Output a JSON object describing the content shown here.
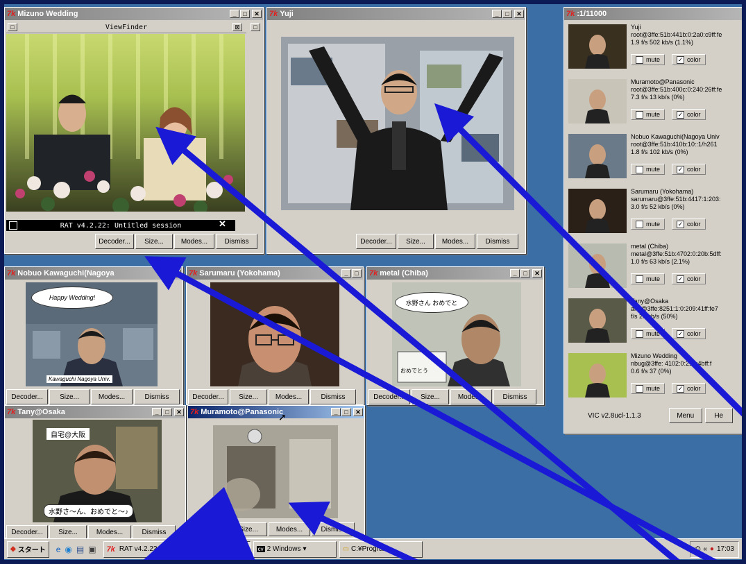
{
  "windows": {
    "mizuno": {
      "title": "Mizuno Wedding",
      "viewfinder": "ViewFinder",
      "rat_session": "RAT v4.2.22: Untitled session",
      "buttons": [
        "Decoder...",
        "Size...",
        "Modes...",
        "Dismiss"
      ]
    },
    "yuji": {
      "title": "Yuji",
      "buttons": [
        "Decoder...",
        "Size...",
        "Modes...",
        "Dismiss"
      ]
    },
    "nobuo": {
      "title": "Nobuo Kawaguchi(Nagoya",
      "speech_top": "Happy Wedding!",
      "speech_bottom": "Kawaguchi Nagoya Univ.",
      "buttons": [
        "Decoder...",
        "Size...",
        "Modes...",
        "Dismiss"
      ]
    },
    "sarumaru": {
      "title": "Sarumaru (Yokohama)",
      "buttons": [
        "Decoder...",
        "Size...",
        "Modes...",
        "Dismiss"
      ]
    },
    "metal": {
      "title": "metal (Chiba)",
      "speech": "水野さん おめでと",
      "sign": "おめでとう",
      "buttons": [
        "Decoder...",
        "Size...",
        "Modes...",
        "Dismiss"
      ]
    },
    "tany": {
      "title": "Tany@Osaka",
      "caption_top": "自宅@大阪",
      "caption_bottom": "水野さ〜ん、おめでと〜♪",
      "buttons": [
        "Decoder...",
        "Size...",
        "Modes...",
        "Dismiss"
      ]
    },
    "muramoto": {
      "title": "Muramoto@Panasonic",
      "buttons": [
        "Size...",
        "Modes...",
        "Dismiss"
      ]
    }
  },
  "vic": {
    "title": ":1/11000",
    "mute_label": "mute",
    "color_label": "color",
    "entries": [
      {
        "name": "Yuji",
        "addr": "root@3ffe:51b:441b:0:2a0:c9ff:fe",
        "stats": "1.9 f/s   502 kb/s  (1.1%)"
      },
      {
        "name": "Muramoto@Panasonic",
        "addr": "root@3ffe:51b:400c:0:240:26ff:fe",
        "stats": "7.3 f/s    13 kb/s    (0%)"
      },
      {
        "name": "Nobuo Kawaguchi(Nagoya Univ",
        "addr": "root@3ffe:51b:410b:10::1/h261",
        "stats": "1.8 f/s   102 kb/s    (0%)"
      },
      {
        "name": "Sarumaru (Yokohama)",
        "addr": "sarumaru@3ffe:51b:4417:1:203:",
        "stats": "3.0 f/s    52 kb/s    (0%)"
      },
      {
        "name": "metal (Chiba)",
        "addr": "metal@3ffe:51b:4702:0:20b:5dff:",
        "stats": "1.0 f/s    63 kb/s  (2.1%)"
      },
      {
        "name": "Tany@Osaka",
        "addr": "any@3ffe:8251:1:0:209:41ff:fe7",
        "stats": "f/s    26 kb/s   (50%)"
      },
      {
        "name": "Mizuno Wedding",
        "addr": "nbug@3ffe:  4102:0:210:4bff:f",
        "stats": "0.6 f/s    37        (0%)"
      }
    ],
    "footer_version": "VIC v2.8ucl-1.1.3",
    "menu_label": "Menu",
    "help_label": "He"
  },
  "taskbar": {
    "start_label": "スタート",
    "items": [
      "RAT v4.2.22:",
      "Camtasia",
      "2 Windows",
      "C:¥Program ..."
    ],
    "clock": "17:03"
  },
  "colors": {
    "desktop": "#3a6ea5",
    "arrow": "#1a1ad6",
    "active_title": "#0a246a"
  }
}
